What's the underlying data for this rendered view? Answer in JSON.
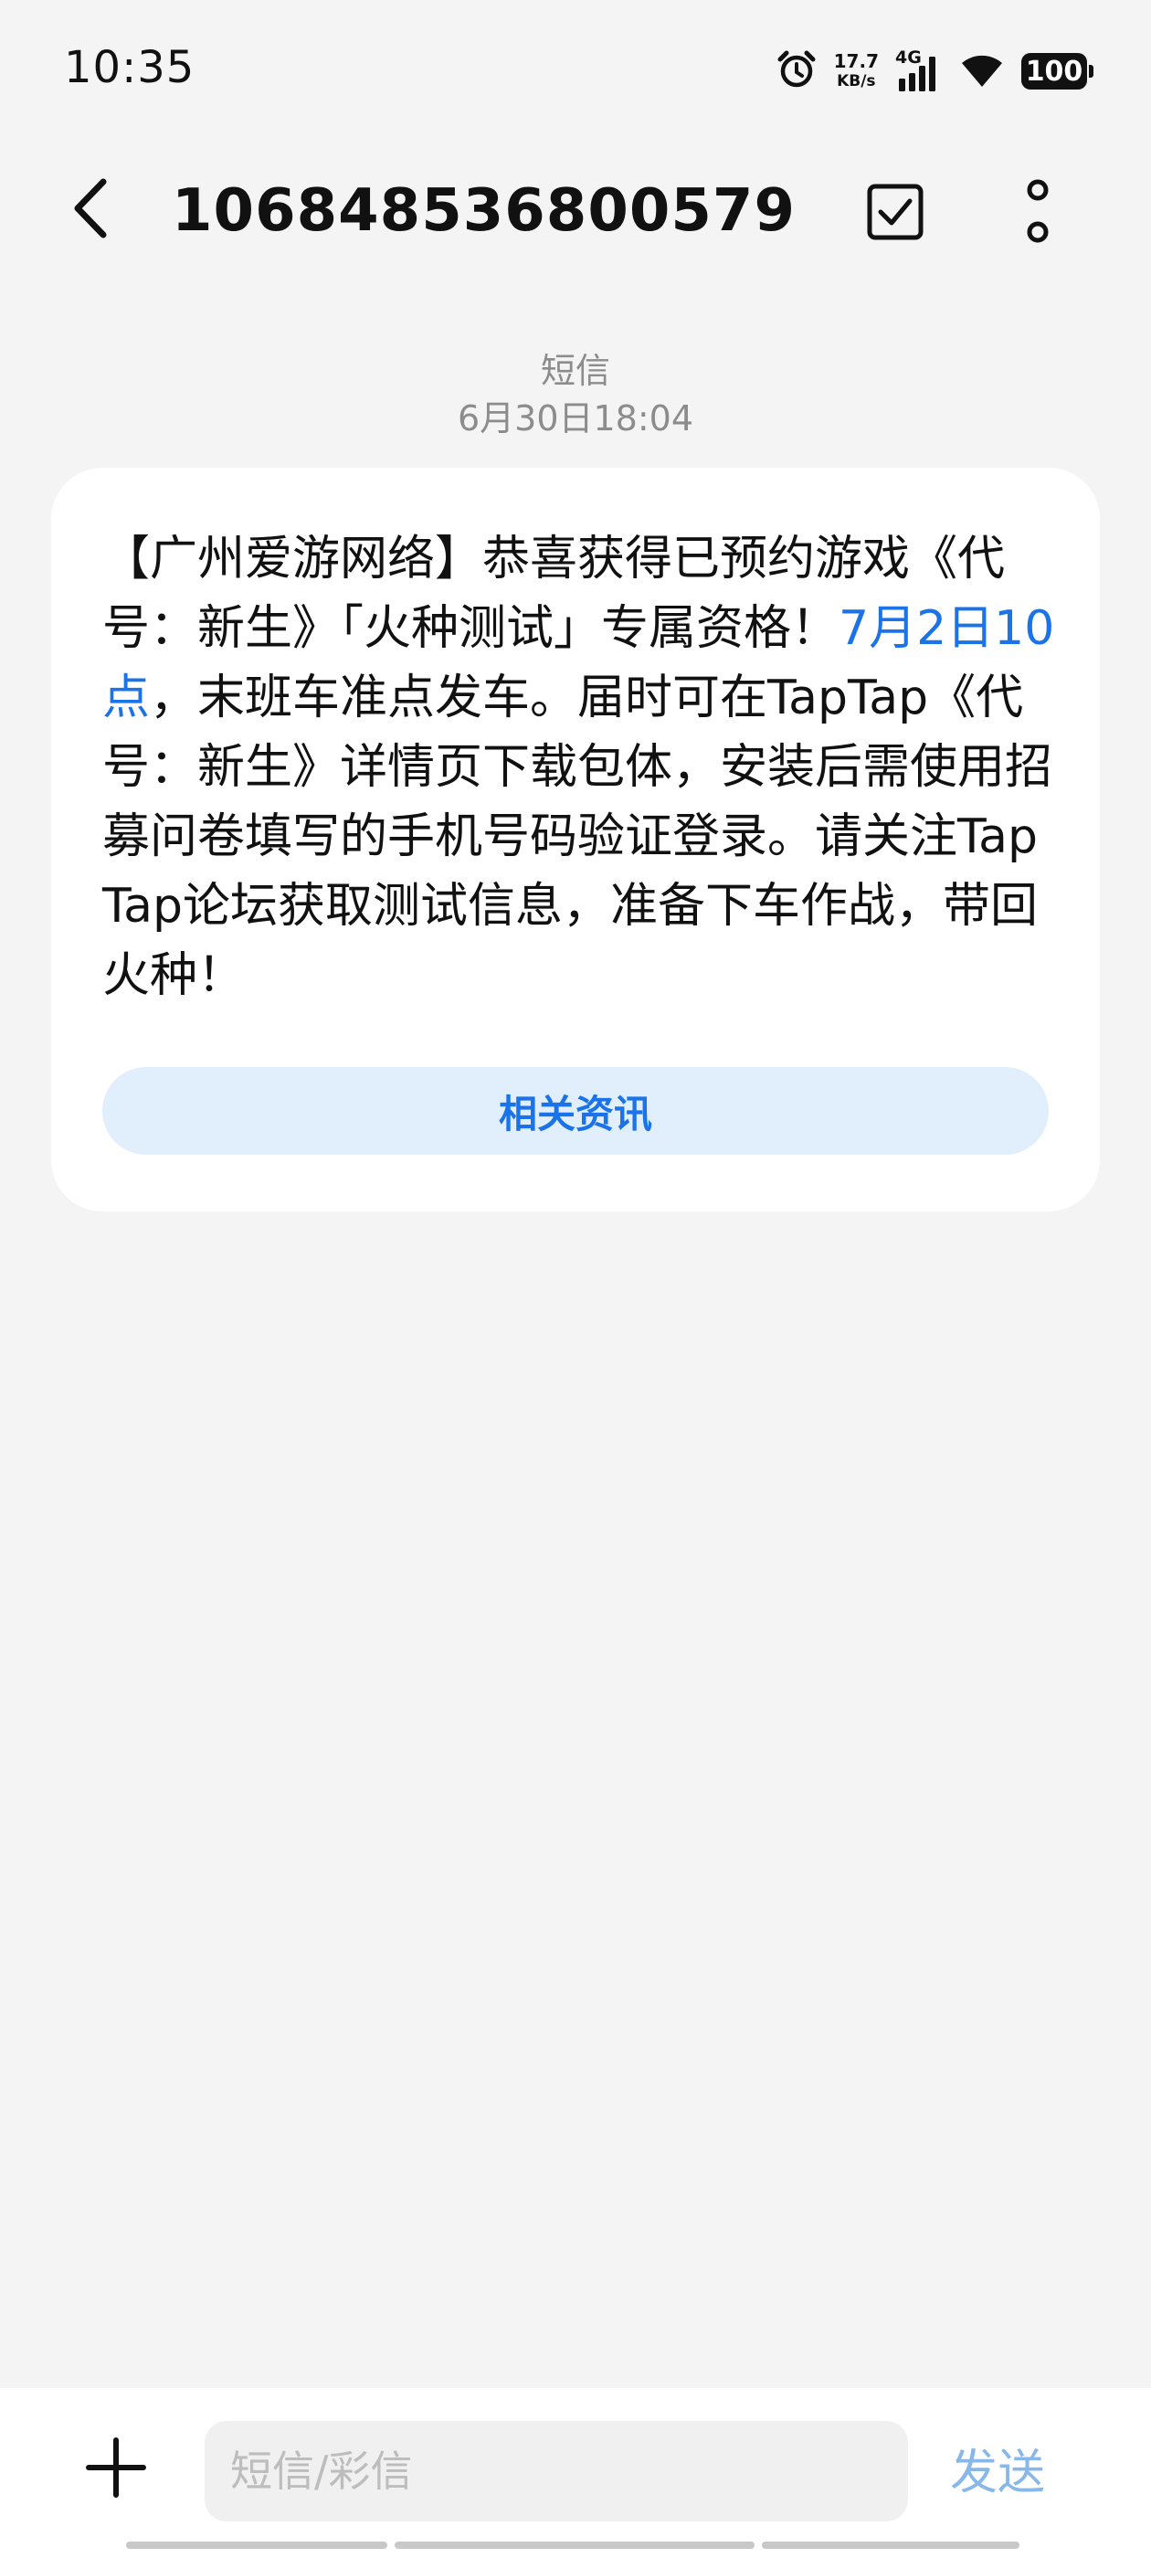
{
  "status_bar": {
    "time": "10:35",
    "net_speed_value": "17.7",
    "net_speed_unit": "KB/s",
    "network_type": "4G",
    "battery": "100",
    "icons": [
      "alarm-icon",
      "signal-icon",
      "wifi-icon",
      "battery-icon"
    ]
  },
  "header": {
    "title": "106848536800579",
    "back_icon": "chevron-left-icon",
    "select_icon": "checkbox-icon",
    "more_icon": "more-vertical-icon"
  },
  "message": {
    "type_label": "短信",
    "timestamp": "6月30日18:04",
    "text_before_link": "【广州爱游网络】恭喜获得已预约游戏《代号：新生》「火种测试」专属资格！",
    "link_text": "7月2日10点",
    "text_after_link": "，末班车准点发车。届时可在TapTap《代号：新生》详情页下载包体，安装后需使用招募问卷填写的手机号码验证登录。请关注TapTap论坛获取测试信息，准备下车作战，带回火种！",
    "related_button_label": "相关资讯"
  },
  "composer": {
    "add_icon": "plus-icon",
    "placeholder": "短信/彩信",
    "value": "",
    "send_label": "发送"
  },
  "colors": {
    "link": "#1a73e8",
    "button_bg": "#e1eefb",
    "send_disabled": "#88b8ea",
    "background": "#f4f4f4"
  }
}
